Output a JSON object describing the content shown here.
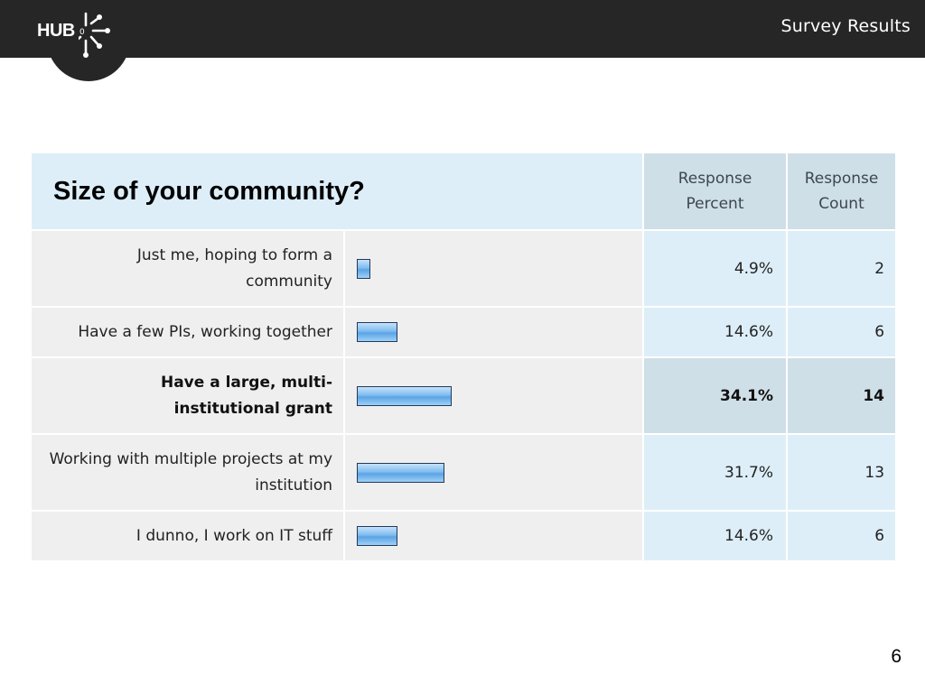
{
  "header": {
    "logo_text": "HUB",
    "title": "Survey Results"
  },
  "question": {
    "title": "Size of your community?",
    "col_percent": [
      "Response",
      "Percent"
    ],
    "col_count": [
      "Response",
      "Count"
    ],
    "answers": [
      {
        "label": "Just me, hoping to form a community",
        "percent_text": "4.9%",
        "percent": 4.9,
        "count": "2",
        "highlight": false
      },
      {
        "label": "Have a few PIs, working together",
        "percent_text": "14.6%",
        "percent": 14.6,
        "count": "6",
        "highlight": false
      },
      {
        "label": "Have a large, multi-institutional grant",
        "percent_text": "34.1%",
        "percent": 34.1,
        "count": "14",
        "highlight": true
      },
      {
        "label": "Working with multiple projects at my institution",
        "percent_text": "31.7%",
        "percent": 31.7,
        "count": "13",
        "highlight": false
      },
      {
        "label": "I dunno, I work on IT stuff",
        "percent_text": "14.6%",
        "percent": 14.6,
        "count": "6",
        "highlight": false
      }
    ]
  },
  "footer": {
    "page_number": "6"
  },
  "colors": {
    "header_bg": "#262626",
    "table_header_bg": "#ddeef8",
    "highlight_bg": "#cfdfe8",
    "label_bg": "#efefef",
    "bar_fill": "#7fbcef"
  }
}
